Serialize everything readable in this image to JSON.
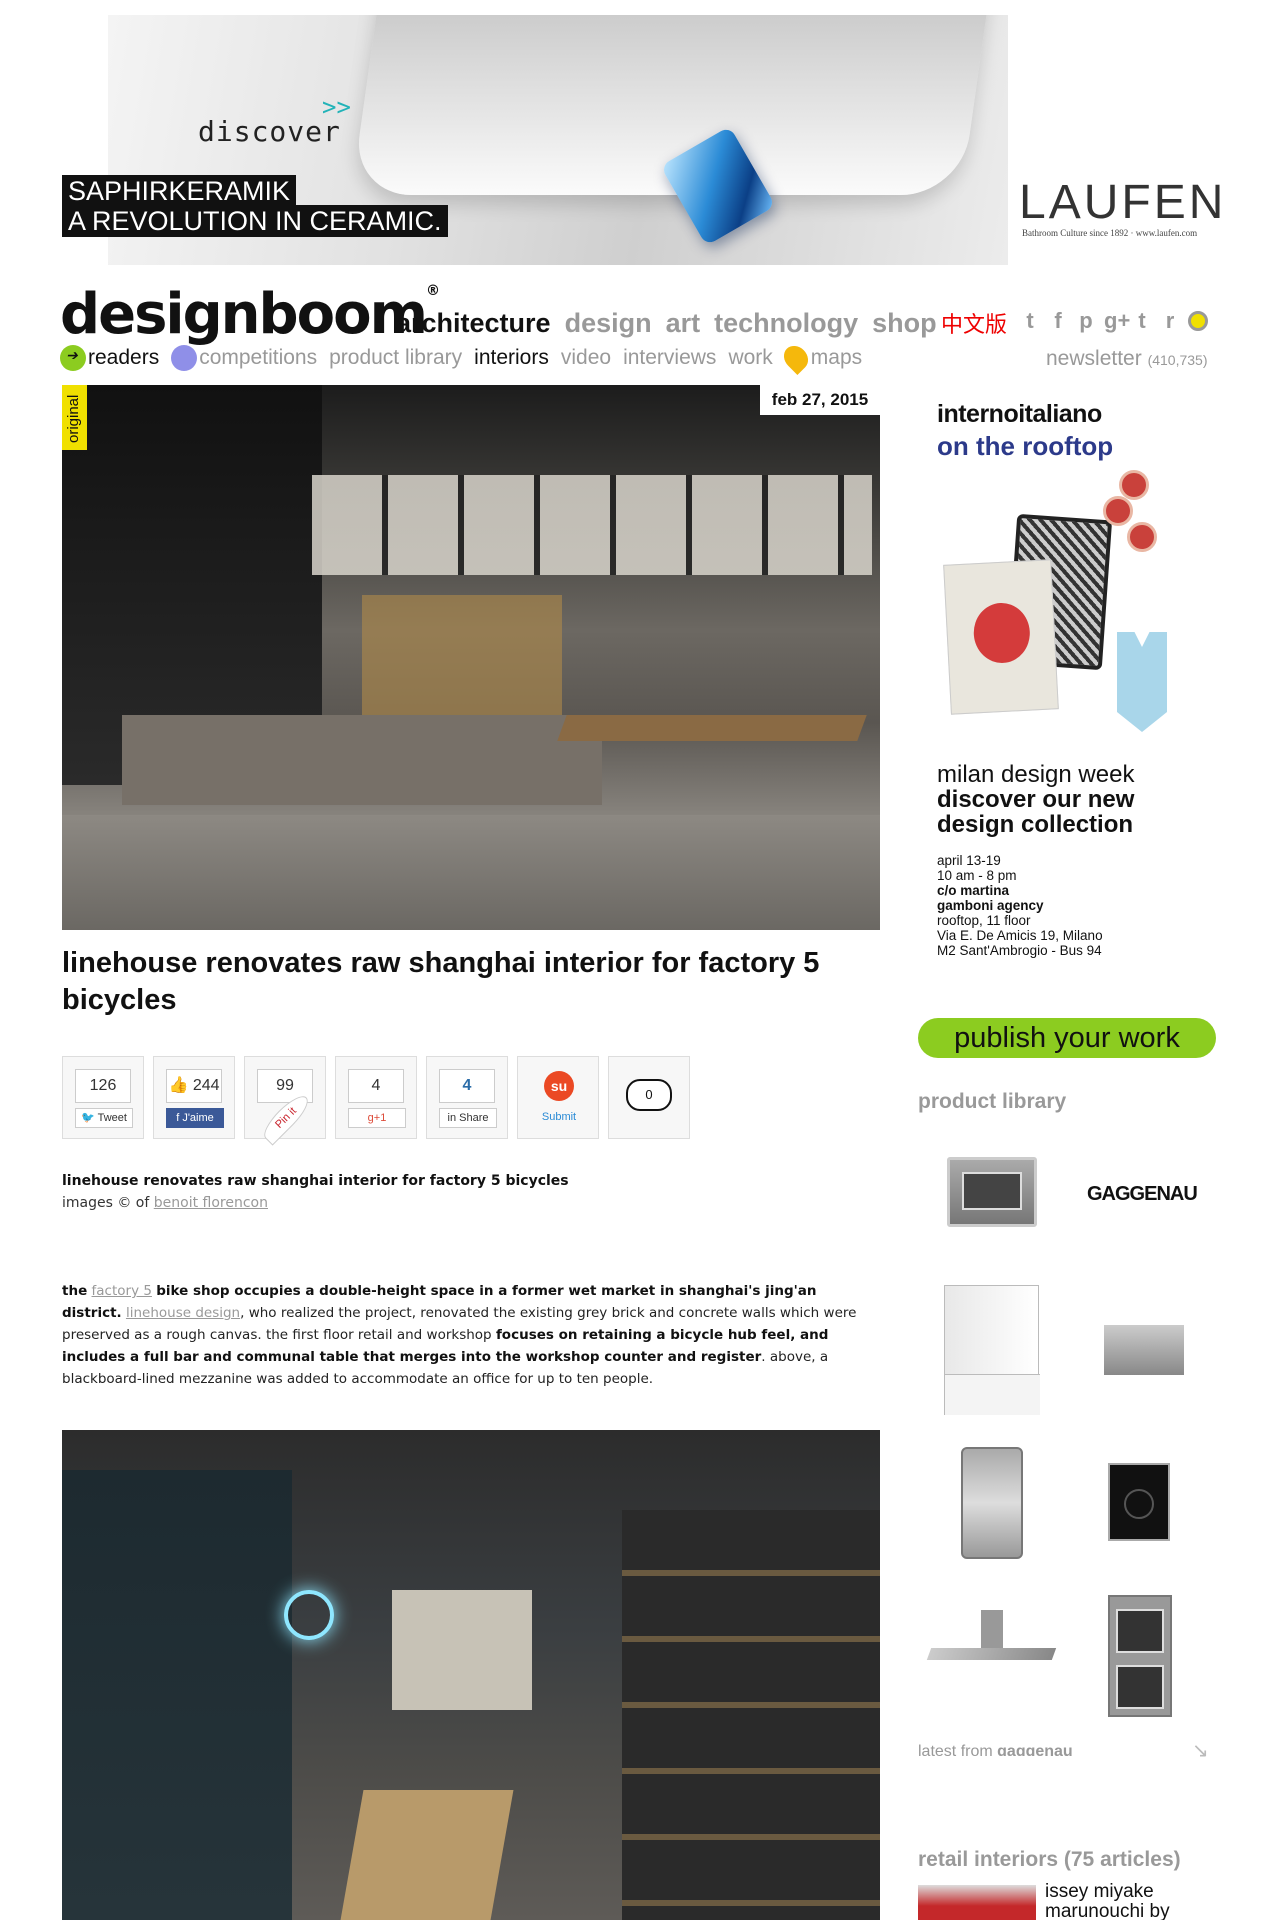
{
  "banner": {
    "discover": "discover",
    "discover_arrow": ">>",
    "line1": "SAPHIRKERAMIK",
    "line2": "A REVOLUTION IN CERAMIC.",
    "brand": "LAUFEN",
    "brand_sub": "Bathroom Culture since 1892 · www.laufen.com"
  },
  "header": {
    "logo": "designboom",
    "logo_mark": "®",
    "nav_main": [
      "architecture",
      "design",
      "art",
      "technology",
      "shop"
    ],
    "active_main": "architecture",
    "lang": "中文版",
    "social_icons": [
      "twitter-icon",
      "facebook-icon",
      "pinterest-icon",
      "google-plus-icon",
      "tumblr-icon",
      "rss-icon",
      "search-icon"
    ],
    "social_glyphs": [
      "t",
      "f",
      "p",
      "g+",
      "t",
      "r"
    ],
    "nav_sub": [
      "readers",
      "competitions",
      "product library",
      "interiors",
      "video",
      "interviews",
      "work",
      "maps"
    ],
    "newsletter": "newsletter",
    "newsletter_count": "(410,735)"
  },
  "article": {
    "badge": "original",
    "date": "feb 27, 2015",
    "title": "linehouse renovates raw shanghai interior for factory 5 bicycles",
    "shares": {
      "tweet_count": "126",
      "tweet_label": "Tweet",
      "fb_count": "244",
      "fb_label": "J'aime",
      "pin_count": "99",
      "pin_label": "Pin it",
      "gplus_count": "4",
      "gplus_label": "+1",
      "linkedin_count": "4",
      "linkedin_label": "Share",
      "stumble_label": "Submit",
      "comments_count": "0"
    },
    "caption_title": "linehouse renovates raw shanghai interior for factory 5 bicycles",
    "caption_images": "images © of",
    "caption_credit": "benoit florencon",
    "para": {
      "p1": "the",
      "link1": "factory 5",
      "p2": "bike shop occupies a double-height space in a former wet market in shanghai's jing'an district.",
      "link2": "linehouse design",
      "p3": ", who realized the project, renovated the existing grey brick and concrete walls which were preserved as a rough canvas. the first floor retail and workshop",
      "p4": "focuses on retaining a bicycle hub feel, and includes a full bar and communal table that merges into the workshop counter and register",
      "p5": ". above, a blackboard-lined mezzanine was added to accommodate an office for up to ten people."
    }
  },
  "sidebar": {
    "ad": {
      "logo1": "internoitaliano",
      "logo2": "on the rooftop",
      "h1": "milan design week",
      "h2": "discover our new",
      "h3": "design collection",
      "lines": [
        "april 13-19",
        "10 am - 8 pm",
        "c/o martina",
        "gamboni agency",
        "rooftop, 11 floor",
        "Via E. De Amicis 19, Milano",
        "M2 Sant'Ambrogio - Bus 94"
      ]
    },
    "publish": "publish your work",
    "product_library": "product library",
    "gaggenau": "GAGGENAU",
    "latest_prefix": "latest from",
    "latest_brand": "gaggenau",
    "retail_title": "retail interiors (75 articles)",
    "related_title": "issey miyake marunouchi by"
  }
}
